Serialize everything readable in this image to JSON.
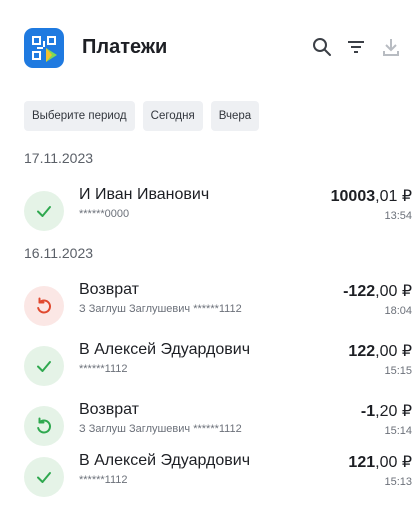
{
  "header": {
    "title": "Платежи",
    "logo_icon": "qr-payment-logo-icon",
    "actions": [
      {
        "name": "search-icon"
      },
      {
        "name": "filter-icon"
      },
      {
        "name": "download-icon"
      }
    ]
  },
  "period_chips": [
    "Выберите период",
    "Сегодня",
    "Вчера"
  ],
  "groups": [
    {
      "date": "17.11.2023",
      "items": [
        {
          "icon": "checkmark-icon",
          "status": "success",
          "name": "И Иван Иванович",
          "sub": "******0000",
          "amount_int": "10003",
          "amount_frac": ",01 ₽",
          "time": "13:54"
        }
      ]
    },
    {
      "date": "16.11.2023",
      "items": [
        {
          "icon": "refund-icon",
          "status": "refund",
          "name": "Возврат",
          "sub": "З Заглуш Заглушевич ******1112",
          "amount_int": "-122",
          "amount_frac": ",00 ₽",
          "time": "18:04"
        },
        {
          "icon": "checkmark-icon",
          "status": "success",
          "name": "В Алексей Эдуардович",
          "sub": "******1112",
          "amount_int": "122",
          "amount_frac": ",00 ₽",
          "time": "15:15"
        },
        {
          "icon": "refund-done-icon",
          "status": "refund-success",
          "name": "Возврат",
          "sub": "З Заглуш Заглушевич ******1112",
          "amount_int": "-1",
          "amount_frac": ",20 ₽",
          "time": "15:14"
        },
        {
          "icon": "checkmark-icon",
          "status": "success",
          "name": "В Алексей Эдуардович",
          "sub": "******1112",
          "amount_int": "121",
          "amount_frac": ",00 ₽",
          "time": "15:13"
        }
      ]
    }
  ],
  "colors": {
    "success": "#2fa84f",
    "refund": "#e0492f",
    "accent": "#1f7ae0"
  }
}
